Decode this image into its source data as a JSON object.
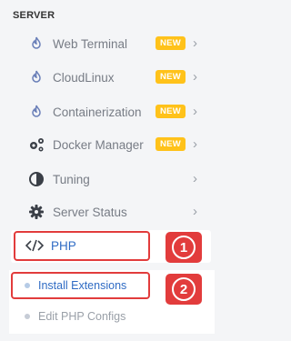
{
  "section": {
    "title": "SERVER"
  },
  "menu": [
    {
      "label": "Web Terminal",
      "badge": "NEW",
      "icon": "flame-icon"
    },
    {
      "label": "CloudLinux",
      "badge": "NEW",
      "icon": "flame-icon"
    },
    {
      "label": "Containerization",
      "badge": "NEW",
      "icon": "flame-icon"
    },
    {
      "label": "Docker Manager",
      "badge": "NEW",
      "icon": "gears-icon"
    },
    {
      "label": "Tuning",
      "badge": "",
      "icon": "contrast-icon"
    },
    {
      "label": "Server Status",
      "badge": "",
      "icon": "cog-icon"
    }
  ],
  "php": {
    "label": "PHP",
    "icon": "code-icon"
  },
  "php_submenu": [
    {
      "label": "Install Extensions",
      "active": true
    },
    {
      "label": "Edit PHP Configs",
      "active": false
    }
  ],
  "steps": [
    "1",
    "2"
  ],
  "colors": {
    "accent": "#2f6bc4",
    "badge": "#ffc21a",
    "highlight": "#e23c3c",
    "icon": "#6a7fb8"
  },
  "chevron": "›"
}
